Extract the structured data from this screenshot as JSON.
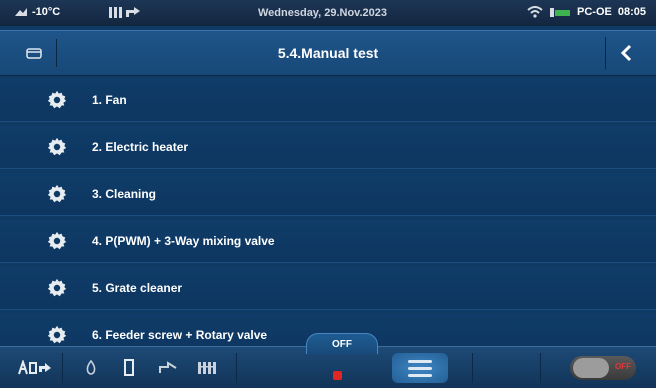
{
  "status": {
    "temperature": "-10°C",
    "date": "Wednesday, 29.Nov.2023",
    "user": "PC-OE",
    "time": "08:05"
  },
  "header": {
    "title": "5.4.Manual test"
  },
  "items": [
    {
      "label": "1.  Fan"
    },
    {
      "label": "2.  Electric heater"
    },
    {
      "label": "3.  Cleaning"
    },
    {
      "label": "4.  P(PWM) + 3-Way mixing valve"
    },
    {
      "label": "5.  Grate cleaner"
    },
    {
      "label": "6.  Feeder screw + Rotary valve"
    }
  ],
  "bottom": {
    "off_tab": "OFF",
    "toggle_label": "OFF"
  },
  "colors": {
    "background": "#0f3a64",
    "accent_red": "#e22525",
    "battery_green": "#3fb34f"
  },
  "icons": [
    "temperature-icon",
    "system-icon",
    "wifi-icon",
    "battery-icon",
    "folder-icon",
    "back-icon",
    "gear-icon",
    "menu-icon"
  ]
}
